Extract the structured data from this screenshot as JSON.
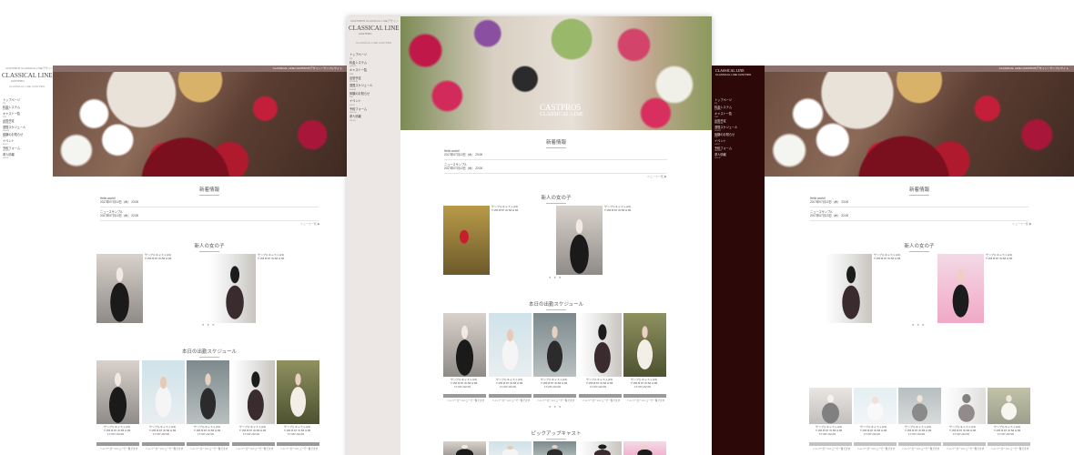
{
  "brand": {
    "logo": "CLASSICAL LINE",
    "sub": "CASTPRO",
    "tagline_top": "CASTPRO5 CLASSICAL LINEデザイン",
    "tagline_side": "CLASSICAL LINE CASTPRO",
    "hero_title": "CASTPRO5",
    "hero_sub": "CLASSICAL LINE"
  },
  "topbar_text": "CLASSICAL LINE CASTPRO5デザイン / サンプルサイト",
  "nav": [
    {
      "label": "トップページ",
      "sub": "top"
    },
    {
      "label": "料金システム",
      "sub": "system"
    },
    {
      "label": "キャスト一覧",
      "sub": "cast"
    },
    {
      "label": "出勤予定",
      "sub": "schedule"
    },
    {
      "label": "週間スケジュール",
      "sub": "weekly"
    },
    {
      "label": "体験のお知らせ",
      "sub": "trial"
    },
    {
      "label": "イベント",
      "sub": "event"
    },
    {
      "label": "予約フォーム",
      "sub": "reserve"
    },
    {
      "label": "求人情報",
      "sub": "recruit"
    }
  ],
  "sections": {
    "news": "新着情報",
    "newface": "新人の女の子",
    "today": "本日の出勤スケジュール",
    "pickup": "ピックアップキャスト"
  },
  "news_items": [
    {
      "title": "Hello world!",
      "date": "2017年07月13日（木） 23:00"
    },
    {
      "title": "ニュースサンプル",
      "date": "2017年07月13日（木） 22:00"
    }
  ],
  "more_link": "ニュース一覧 ▶",
  "cast_name": "サンプルキャスト(21)",
  "cast_size": "T:155 B:87 W:58 H:86",
  "cast_time": "17:00～02:00",
  "cast_link": "ハンバーガーメニューで一覧でます",
  "dots": "● ● ●"
}
